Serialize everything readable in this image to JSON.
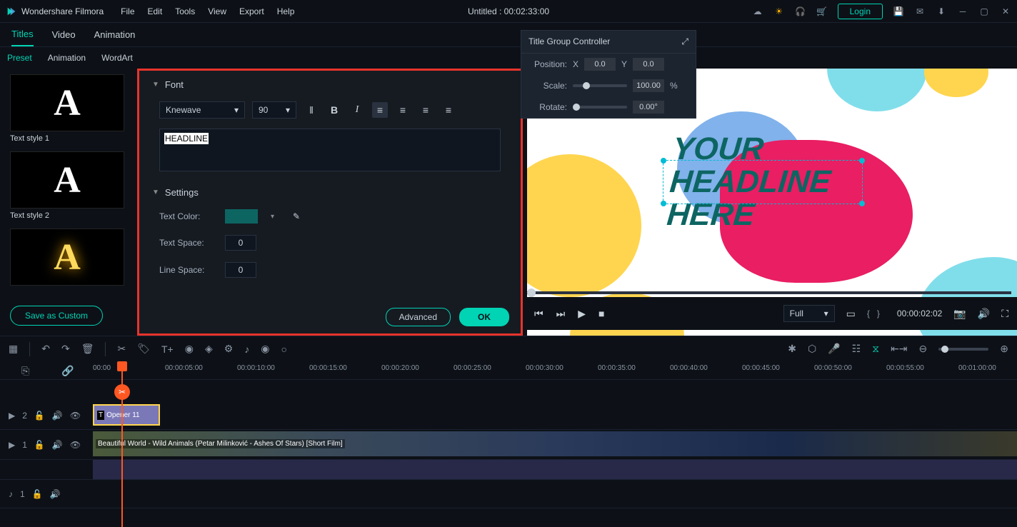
{
  "app": {
    "name": "Wondershare Filmora"
  },
  "menu": {
    "file": "File",
    "edit": "Edit",
    "tools": "Tools",
    "view": "View",
    "export": "Export",
    "help": "Help"
  },
  "title": "Untitled : 00:02:33:00",
  "login": "Login",
  "tabs": {
    "titles": "Titles",
    "video": "Video",
    "animation": "Animation"
  },
  "subtabs": {
    "preset": "Preset",
    "animation": "Animation",
    "wordart": "WordArt"
  },
  "styles": {
    "s1": "Text style 1",
    "s2": "Text style 2"
  },
  "saveCustom": "Save as Custom",
  "editor": {
    "fontSection": "Font",
    "fontName": "Knewave",
    "fontSize": "90",
    "headline": "HEADLINE",
    "settingsSection": "Settings",
    "textColor": "Text Color:",
    "textSpace": "Text Space:",
    "textSpaceVal": "0",
    "lineSpace": "Line Space:",
    "lineSpaceVal": "0",
    "advanced": "Advanced",
    "ok": "OK"
  },
  "floatPanel": {
    "title": "Title Group Controller",
    "position": "Position:",
    "x": "X",
    "xv": "0.0",
    "y": "Y",
    "yv": "0.0",
    "scale": "Scale:",
    "scaleVal": "100.00",
    "pct": "%",
    "rotate": "Rotate:",
    "rotateVal": "0.00°"
  },
  "preview": {
    "line1": "YOUR",
    "line2": "HEADLINE",
    "line3": "HERE"
  },
  "player": {
    "full": "Full",
    "timestamp": "00:00:02:02"
  },
  "timeline": {
    "marks": [
      "00:00",
      "00:00:05:00",
      "00:00:10:00",
      "00:00:15:00",
      "00:00:20:00",
      "00:00:25:00",
      "00:00:30:00",
      "00:00:35:00",
      "00:00:40:00",
      "00:00:45:00",
      "00:00:50:00",
      "00:00:55:00",
      "00:01:00:00"
    ],
    "titleClip": "Opener 11",
    "videoClip": "Beautiful World - Wild Animals (Petar Milinković - Ashes Of Stars) [Short Film]",
    "trackT": "2",
    "trackV": "1",
    "trackA": "1"
  }
}
